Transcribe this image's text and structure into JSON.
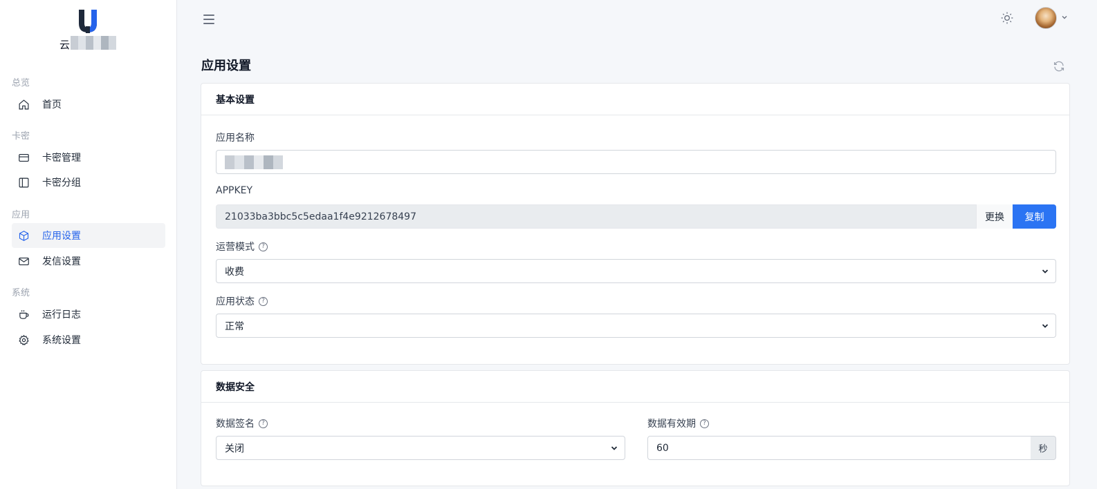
{
  "brand": {
    "visible_char": "云",
    "logo_icon": "u-logo-icon",
    "blur_colors": [
      "#c8cdd4",
      "#dfe3e8",
      "#b9c0c9",
      "#e6e9ed",
      "#aeb6bf",
      "#d3d8de"
    ]
  },
  "sidebar": {
    "sections": [
      {
        "title": "总览",
        "items": [
          {
            "label": "首页",
            "icon": "home-icon"
          }
        ]
      },
      {
        "title": "卡密",
        "items": [
          {
            "label": "卡密管理",
            "icon": "card-icon"
          },
          {
            "label": "卡密分组",
            "icon": "sidebar-layout-icon"
          }
        ]
      },
      {
        "title": "应用",
        "items": [
          {
            "label": "应用设置",
            "icon": "cube-icon",
            "active": true
          },
          {
            "label": "发信设置",
            "icon": "mail-icon"
          }
        ]
      },
      {
        "title": "系统",
        "items": [
          {
            "label": "运行日志",
            "icon": "coffee-cup-icon"
          },
          {
            "label": "系统设置",
            "icon": "gear-icon"
          }
        ]
      }
    ]
  },
  "topbar": {
    "menu_icon": "hamburger-icon",
    "theme_icon": "sun-icon",
    "avatar_icon": "user-avatar"
  },
  "page": {
    "title": "应用设置",
    "refresh_icon": "refresh-icon"
  },
  "basic": {
    "header": "基本设置",
    "app_name_label": "应用名称",
    "appkey_label": "APPKEY",
    "appkey_value": "21033ba3bbc5c5edaa1f4e9212678497",
    "replace_button": "更换",
    "copy_button": "复制",
    "mode_label": "运营模式",
    "mode_value": "收费",
    "status_label": "应用状态",
    "status_value": "正常",
    "help_glyph": "?"
  },
  "security": {
    "header": "数据安全",
    "sign_label": "数据签名",
    "sign_value": "关闭",
    "validity_label": "数据有效期",
    "validity_value": "60",
    "validity_unit": "秒"
  },
  "colors": {
    "accent": "#2b74f3",
    "active_nav": "#2563eb"
  }
}
